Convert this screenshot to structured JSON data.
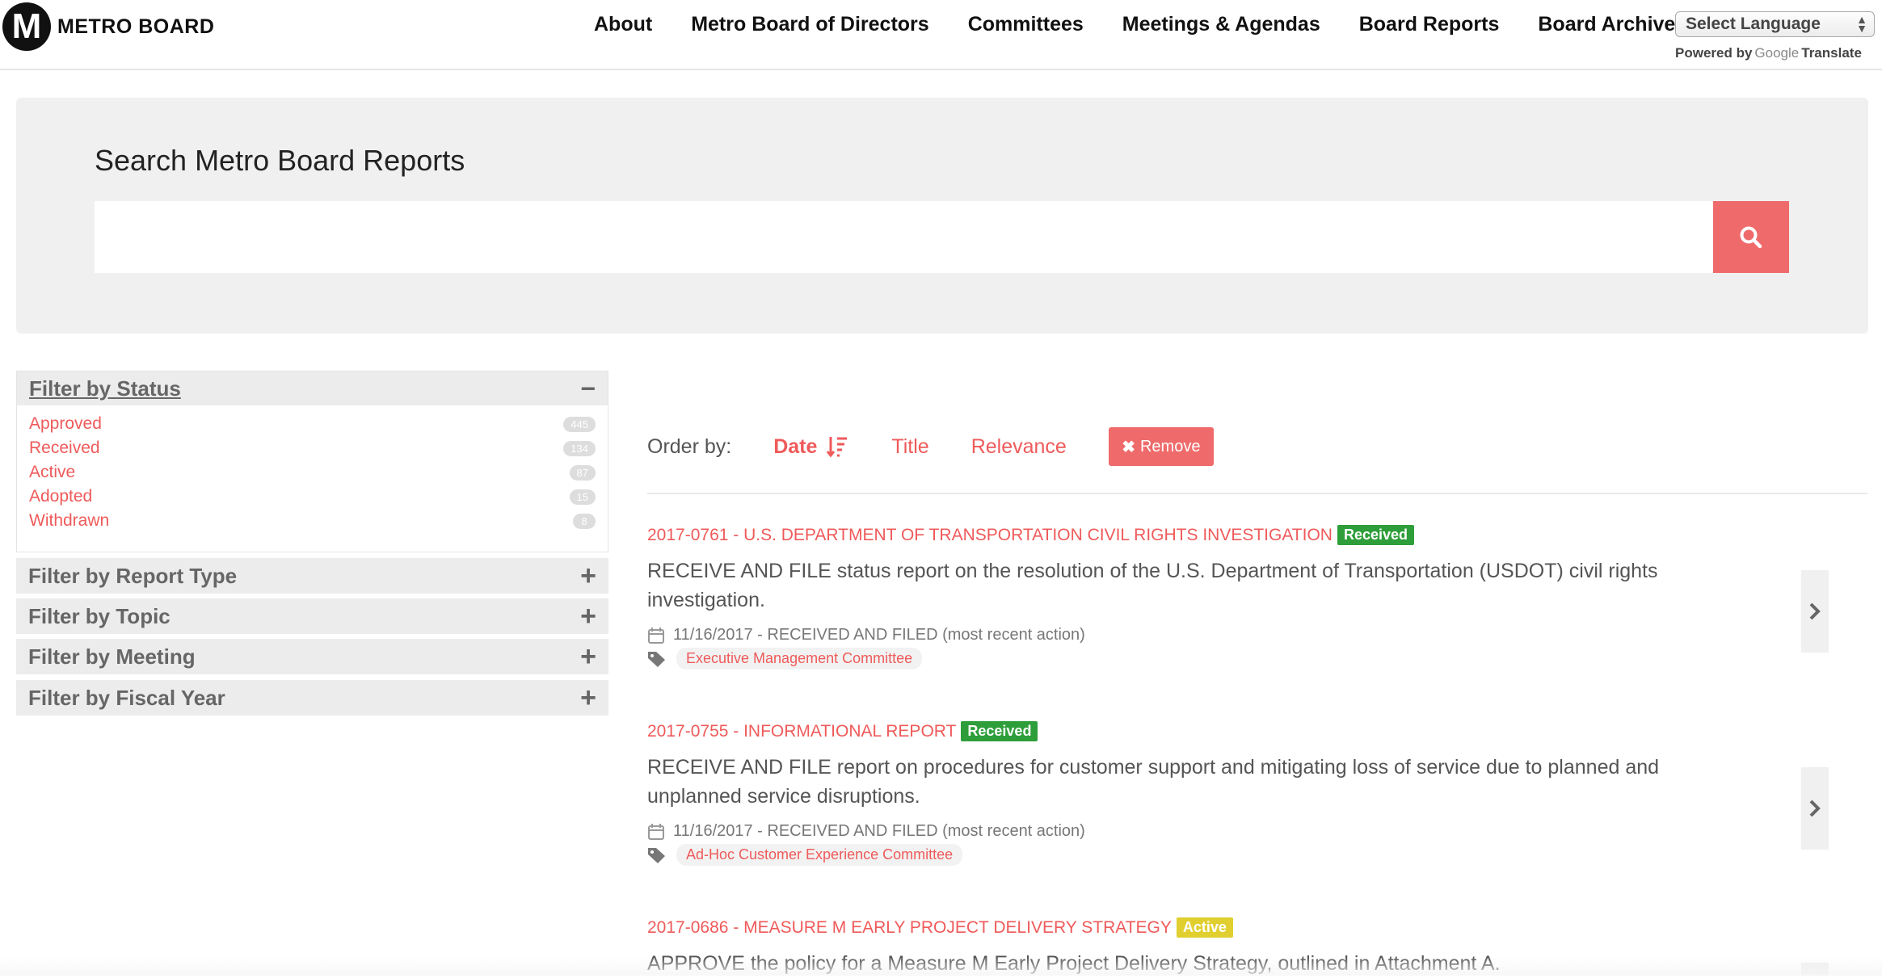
{
  "header": {
    "logo_letter": "M",
    "logo_text": "METRO BOARD",
    "nav": [
      "About",
      "Metro Board of Directors",
      "Committees",
      "Meetings & Agendas",
      "Board Reports",
      "Board Archive"
    ],
    "language_select": "Select Language",
    "powered_by": "Powered by",
    "google": "Google",
    "translate": "Translate"
  },
  "search": {
    "title": "Search Metro Board Reports",
    "value": "",
    "button_icon": "search-icon"
  },
  "filters": {
    "status": {
      "title": "Filter by Status",
      "toggle": "−",
      "items": [
        {
          "label": "Approved",
          "count": "445"
        },
        {
          "label": "Received",
          "count": "134"
        },
        {
          "label": "Active",
          "count": "87"
        },
        {
          "label": "Adopted",
          "count": "15"
        },
        {
          "label": "Withdrawn",
          "count": "8"
        }
      ]
    },
    "collapsed": [
      {
        "title": "Filter by Report Type",
        "toggle": "+"
      },
      {
        "title": "Filter by Topic",
        "toggle": "+"
      },
      {
        "title": "Filter by Meeting",
        "toggle": "+"
      },
      {
        "title": "Filter by Fiscal Year",
        "toggle": "+"
      }
    ]
  },
  "order": {
    "label": "Order by:",
    "options": [
      "Date",
      "Title",
      "Relevance"
    ],
    "active": "Date",
    "remove_label": "Remove"
  },
  "results": [
    {
      "title": "2017-0761 - U.S. DEPARTMENT OF TRANSPORTATION CIVIL RIGHTS INVESTIGATION",
      "badge": "Received",
      "description": "RECEIVE AND FILE status report on the resolution of the U.S. Department of Transportation (USDOT) civil rights investigation.",
      "date": "11/16/2017 - RECEIVED AND FILED (most recent action)",
      "tag": "Executive Management Committee"
    },
    {
      "title": "2017-0755 - INFORMATIONAL REPORT",
      "badge": "Received",
      "description": "RECEIVE AND FILE report on procedures for customer support and mitigating loss of service due to planned and unplanned service disruptions.",
      "date": "11/16/2017 - RECEIVED AND FILED (most recent action)",
      "tag": "Ad-Hoc Customer Experience Committee"
    },
    {
      "title": "2017-0686 - MEASURE M EARLY PROJECT DELIVERY STRATEGY",
      "badge": "Active",
      "description": "APPROVE the policy for a Measure M Early Project Delivery Strategy, outlined in Attachment A."
    }
  ],
  "colors": {
    "accent": "#ef6b6b",
    "link": "#ef5a5a",
    "received": "#2e9e3a",
    "active": "#e0cf2f"
  }
}
